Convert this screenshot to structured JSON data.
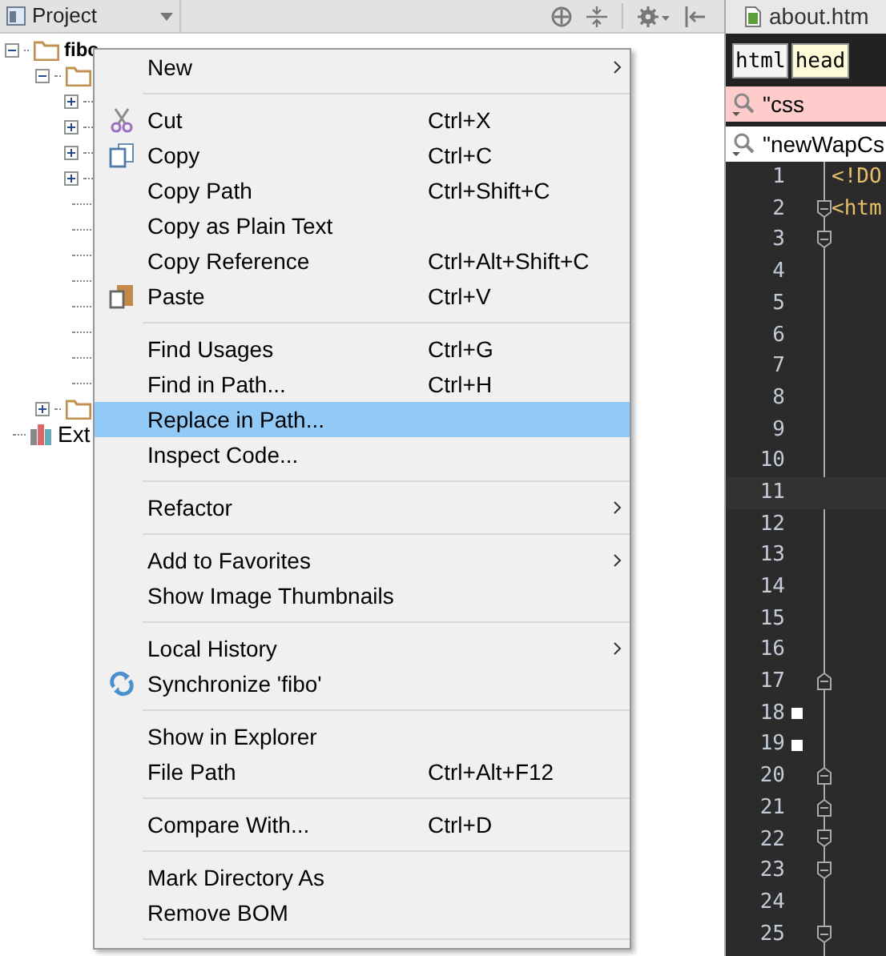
{
  "project_panel": {
    "title": "Project"
  },
  "tree": [
    {
      "label": "fibo",
      "expanded": true,
      "children": [
        {
          "expanded": true,
          "children": [
            {
              "kind": "folder",
              "expanded": false
            },
            {
              "kind": "folder",
              "expanded": false
            },
            {
              "kind": "folder",
              "expanded": false
            },
            {
              "kind": "folder",
              "expanded": false
            },
            {
              "kind": "leaf"
            },
            {
              "kind": "leaf"
            },
            {
              "kind": "leaf"
            },
            {
              "kind": "leaf"
            },
            {
              "kind": "leaf"
            },
            {
              "kind": "leaf"
            },
            {
              "kind": "leaf"
            },
            {
              "kind": "leaf"
            }
          ]
        },
        {
          "expanded": false
        }
      ]
    },
    {
      "label": "Ext"
    }
  ],
  "context_menu": [
    {
      "kind": "item",
      "label": "New",
      "submenu": true,
      "selected": false
    },
    {
      "kind": "separator"
    },
    {
      "kind": "item",
      "label": "Cut",
      "shortcut": "Ctrl+X",
      "has_icon": true,
      "selected": false
    },
    {
      "kind": "item",
      "label": "Copy",
      "shortcut": "Ctrl+C",
      "has_icon": true,
      "selected": false
    },
    {
      "kind": "item",
      "label": "Copy Path",
      "shortcut": "Ctrl+Shift+C",
      "selected": false
    },
    {
      "kind": "item",
      "label": "Copy as Plain Text",
      "selected": false
    },
    {
      "kind": "item",
      "label": "Copy Reference",
      "shortcut": "Ctrl+Alt+Shift+C",
      "selected": false
    },
    {
      "kind": "item",
      "label": "Paste",
      "shortcut": "Ctrl+V",
      "has_icon": true,
      "selected": false
    },
    {
      "kind": "separator"
    },
    {
      "kind": "item",
      "label": "Find Usages",
      "shortcut": "Ctrl+G",
      "selected": false
    },
    {
      "kind": "item",
      "label": "Find in Path...",
      "shortcut": "Ctrl+H",
      "selected": false
    },
    {
      "kind": "item",
      "label": "Replace in Path...",
      "selected": true
    },
    {
      "kind": "item",
      "label": "Inspect Code...",
      "selected": false
    },
    {
      "kind": "separator"
    },
    {
      "kind": "item",
      "label": "Refactor",
      "submenu": true,
      "selected": false
    },
    {
      "kind": "separator"
    },
    {
      "kind": "item",
      "label": "Add to Favorites",
      "submenu": true,
      "selected": false
    },
    {
      "kind": "item",
      "label": "Show Image Thumbnails",
      "selected": false
    },
    {
      "kind": "separator"
    },
    {
      "kind": "item",
      "label": "Local History",
      "submenu": true,
      "selected": false
    },
    {
      "kind": "item",
      "label": "Synchronize 'fibo'",
      "has_icon": true,
      "selected": false
    },
    {
      "kind": "separator"
    },
    {
      "kind": "item",
      "label": "Show in Explorer",
      "selected": false
    },
    {
      "kind": "item",
      "label": "File Path",
      "shortcut": "Ctrl+Alt+F12",
      "selected": false
    },
    {
      "kind": "separator"
    },
    {
      "kind": "item",
      "label": "Compare With...",
      "shortcut": "Ctrl+D",
      "selected": false
    },
    {
      "kind": "separator"
    },
    {
      "kind": "item",
      "label": "Mark Directory As",
      "selected": false
    },
    {
      "kind": "item",
      "label": "Remove BOM",
      "selected": false
    },
    {
      "kind": "separator"
    }
  ],
  "editor": {
    "tab": "about.htm",
    "breadcrumbs": [
      {
        "label": "html",
        "selected": false
      },
      {
        "label": "head",
        "selected": true
      }
    ],
    "sticky_rows": [
      {
        "text": "\"css",
        "highlighted": true
      },
      {
        "text": "\"newWapCs",
        "highlighted": false
      }
    ],
    "lines": [
      {
        "number": "1",
        "code": "<!DO"
      },
      {
        "number": "2",
        "code": "<htm",
        "fold_open": true
      },
      {
        "number": "3",
        "fold_open": true
      },
      {
        "number": "4"
      },
      {
        "number": "5"
      },
      {
        "number": "6"
      },
      {
        "number": "7"
      },
      {
        "number": "8"
      },
      {
        "number": "9"
      },
      {
        "number": "10"
      },
      {
        "number": "11",
        "current": true
      },
      {
        "number": "12"
      },
      {
        "number": "13"
      },
      {
        "number": "14"
      },
      {
        "number": "15"
      },
      {
        "number": "16"
      },
      {
        "number": "17",
        "fold_close": true
      },
      {
        "number": "18",
        "bookmark": true
      },
      {
        "number": "19",
        "bookmark": true
      },
      {
        "number": "20",
        "fold_close": true
      },
      {
        "number": "21",
        "fold_close": true
      },
      {
        "number": "22",
        "fold_open": true
      },
      {
        "number": "23",
        "fold_open": true
      },
      {
        "number": "24"
      },
      {
        "number": "25",
        "fold_open": true
      }
    ]
  }
}
